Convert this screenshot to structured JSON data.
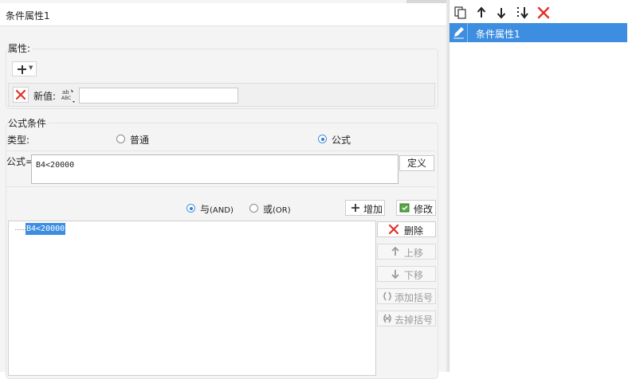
{
  "title": "条件属性1",
  "attribute": {
    "section_title": "属性:",
    "new_value_label": "新值:",
    "new_value": ""
  },
  "formula_condition": {
    "section_title": "公式条件",
    "type_label": "类型:",
    "type_options": [
      {
        "label": "普通",
        "selected": false
      },
      {
        "label": "公式",
        "selected": true
      }
    ],
    "formula_label": "公式=",
    "formula_value": "B4<20000",
    "define_label": "定义",
    "logic_options": [
      {
        "label": "与",
        "suffix": "(AND)",
        "selected": true
      },
      {
        "label": "或",
        "suffix": "(OR)",
        "selected": false
      }
    ],
    "add_label": "增加",
    "modify_label": "修改",
    "conditions": [
      "B4<20000"
    ],
    "side_buttons": {
      "delete": "删除",
      "move_up": "上移",
      "move_down": "下移",
      "add_paren": "添加括号",
      "remove_paren": "去掉括号"
    }
  },
  "attribute_list": {
    "items": [
      {
        "label": "条件属性1",
        "selected": true
      }
    ]
  },
  "colors": {
    "accent": "#3d8ee0",
    "delete_red": "#e0322b",
    "panel_bg": "#f4f4f5"
  },
  "icons": {
    "toolbar": [
      "copy-icon",
      "move-up-icon",
      "move-down-icon",
      "move-bottom-icon",
      "delete-icon"
    ]
  }
}
